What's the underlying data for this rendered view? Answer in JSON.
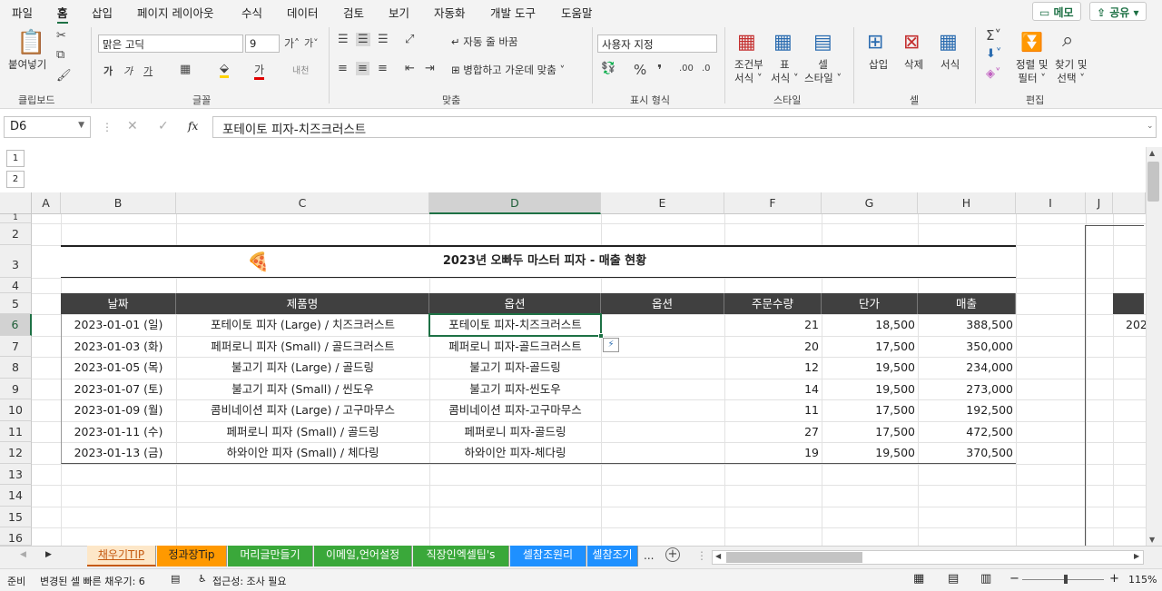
{
  "menu": {
    "items": [
      "파일",
      "홈",
      "삽입",
      "페이지 레이아웃",
      "수식",
      "데이터",
      "검토",
      "보기",
      "자동화",
      "개발 도구",
      "도움말"
    ],
    "memo": "메모",
    "share": "공유"
  },
  "ribbon": {
    "clipboard": {
      "paste": "붙여넣기",
      "label": "클립보드"
    },
    "font": {
      "name": "맑은 고딕",
      "size": "9",
      "label": "글꼴"
    },
    "align": {
      "wrap": "자동 줄 바꿈",
      "merge": "병합하고 가운데 맞춤",
      "label": "맞춤"
    },
    "number": {
      "format": "사용자 지정",
      "label": "표시 형식"
    },
    "styles": {
      "cond1": "조건부",
      "cond2": "서식",
      "table1": "표",
      "table2": "서식",
      "cell1": "셀",
      "cell2": "스타일",
      "label": "스타일"
    },
    "cells": {
      "insert": "삽입",
      "delete": "삭제",
      "format": "서식",
      "label": "셀"
    },
    "edit": {
      "sort1": "정렬 및",
      "sort2": "필터",
      "find1": "찾기 및",
      "find2": "선택",
      "label": "편집"
    }
  },
  "formula_bar": {
    "name_box": "D6",
    "fx": "fx",
    "content": "포테이토 피자-치즈크러스트"
  },
  "outline": {
    "levels": [
      "1",
      "2"
    ]
  },
  "columns": [
    "A",
    "B",
    "C",
    "D",
    "E",
    "F",
    "G",
    "H",
    "I",
    "J"
  ],
  "rows": [
    "1",
    "2",
    "3",
    "4",
    "5",
    "6",
    "7",
    "8",
    "9",
    "10",
    "11",
    "12",
    "13",
    "14",
    "15",
    "16"
  ],
  "sheet": {
    "title": "2023년 오빠두 마스터 피자 - 매출 현황",
    "headers": [
      "날짜",
      "제품명",
      "옵션",
      "옵션",
      "주문수량",
      "단가",
      "매출"
    ],
    "data": [
      [
        "2023-01-01 (일)",
        "포테이토 피자 (Large) / 치즈크러스트",
        "포테이토 피자-치즈크러스트",
        "",
        "21",
        "18,500",
        "388,500"
      ],
      [
        "2023-01-03 (화)",
        "페퍼로니 피자 (Small) / 골드크러스트",
        "페퍼로니 피자-골드크러스트",
        "",
        "20",
        "17,500",
        "350,000"
      ],
      [
        "2023-01-05 (목)",
        "불고기 피자 (Large) / 골드링",
        "불고기 피자-골드링",
        "",
        "12",
        "19,500",
        "234,000"
      ],
      [
        "2023-01-07 (토)",
        "불고기 피자 (Small) / 씬도우",
        "불고기 피자-씬도우",
        "",
        "14",
        "19,500",
        "273,000"
      ],
      [
        "2023-01-09 (월)",
        "콤비네이션 피자 (Large) / 고구마무스",
        "콤비네이션 피자-고구마무스",
        "",
        "11",
        "17,500",
        "192,500"
      ],
      [
        "2023-01-11 (수)",
        "페퍼로니 피자 (Small) / 골드링",
        "페퍼로니 피자-골드링",
        "",
        "27",
        "17,500",
        "472,500"
      ],
      [
        "2023-01-13 (금)",
        "하와이안 피자 (Small) / 체다링",
        "하와이안 피자-체다링",
        "",
        "19",
        "19,500",
        "370,500"
      ]
    ],
    "side_partial": "202"
  },
  "tabs": [
    {
      "label": "채우기TIP",
      "color": "#fde7c8",
      "text": "#c55a11",
      "active": true
    },
    {
      "label": "정과장Tip",
      "color": "#ff9900",
      "text": "#222"
    },
    {
      "label": "머리글만들기",
      "color": "#3aa83a",
      "text": "#fff"
    },
    {
      "label": "이메일,언어설정",
      "color": "#3aa83a",
      "text": "#fff"
    },
    {
      "label": "직장인엑셀팁's",
      "color": "#3aa83a",
      "text": "#fff"
    },
    {
      "label": "셀참조원리",
      "color": "#1e90ff",
      "text": "#fff"
    },
    {
      "label": "셀참조기",
      "color": "#1e90ff",
      "text": "#fff"
    }
  ],
  "tab_more": "...",
  "status": {
    "ready": "준비",
    "flash": "변경된 셀 빠른 채우기: 6",
    "access": "접근성: 조사 필요",
    "zoom": "115%"
  }
}
